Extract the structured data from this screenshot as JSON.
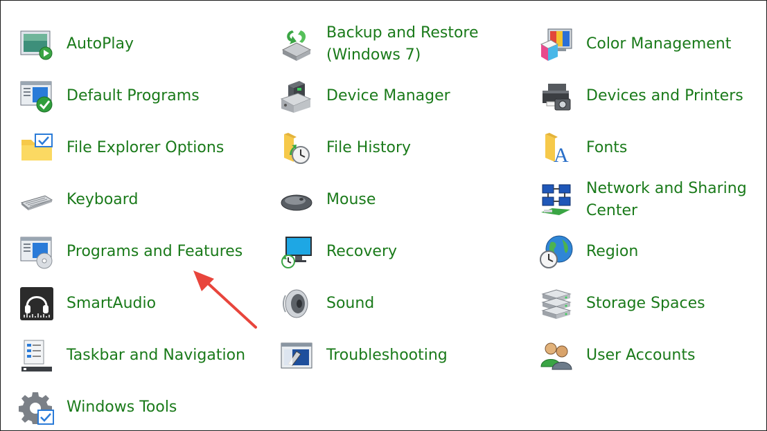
{
  "items": [
    {
      "label": "AutoPlay",
      "icon": "autoplay-icon"
    },
    {
      "label": "Backup and Restore\n(Windows 7)",
      "icon": "backup-restore-icon"
    },
    {
      "label": "Color Management",
      "icon": "color-management-icon"
    },
    {
      "label": "Default Programs",
      "icon": "default-programs-icon"
    },
    {
      "label": "Device Manager",
      "icon": "device-manager-icon"
    },
    {
      "label": "Devices and Printers",
      "icon": "printer-icon"
    },
    {
      "label": "File Explorer Options",
      "icon": "folder-options-icon"
    },
    {
      "label": "File History",
      "icon": "file-history-icon"
    },
    {
      "label": "Fonts",
      "icon": "fonts-icon"
    },
    {
      "label": "Keyboard",
      "icon": "keyboard-icon"
    },
    {
      "label": "Mouse",
      "icon": "mouse-icon"
    },
    {
      "label": "Network and Sharing\nCenter",
      "icon": "network-icon"
    },
    {
      "label": "Programs and Features",
      "icon": "programs-features-icon"
    },
    {
      "label": "Recovery",
      "icon": "recovery-icon"
    },
    {
      "label": "Region",
      "icon": "globe-clock-icon"
    },
    {
      "label": "SmartAudio",
      "icon": "headphones-icon"
    },
    {
      "label": "Sound",
      "icon": "speaker-icon"
    },
    {
      "label": "Storage Spaces",
      "icon": "storage-drives-icon"
    },
    {
      "label": "Taskbar and Navigation",
      "icon": "taskbar-icon"
    },
    {
      "label": "Troubleshooting",
      "icon": "troubleshooting-icon"
    },
    {
      "label": "User Accounts",
      "icon": "users-icon"
    },
    {
      "label": "Windows Tools",
      "icon": "gear-icon"
    }
  ],
  "colors": {
    "link": "#1a7a1a",
    "annotation_arrow": "#e8453c"
  },
  "annotation": {
    "icon": "red-arrow-icon"
  }
}
